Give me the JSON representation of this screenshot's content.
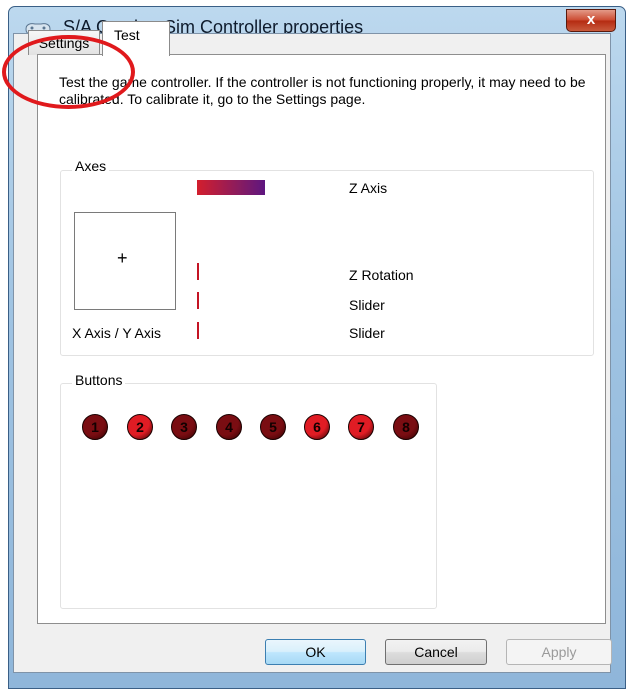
{
  "window": {
    "title": "S/A Combo. Sim Controller properties",
    "close_glyph": "x",
    "icon": "gamepad-icon"
  },
  "tabs": [
    {
      "label": "Settings"
    },
    {
      "label": "Test"
    }
  ],
  "description": "Test the game controller.  If the controller is not functioning properly, it may need to be calibrated.  To calibrate it, go to the Settings page.",
  "axes": {
    "label": "Axes",
    "xy_label": "X Axis / Y Axis",
    "z_axis": "Z Axis",
    "z_rotation": "Z Rotation",
    "slider_1": "Slider",
    "slider_2": "Slider",
    "crosshair": "+"
  },
  "buttons_group": {
    "label": "Buttons",
    "items": [
      {
        "number": "1",
        "color": "#7a0d12"
      },
      {
        "number": "2",
        "color": "#e01c24"
      },
      {
        "number": "3",
        "color": "#7a0d12"
      },
      {
        "number": "4",
        "color": "#7a0d12"
      },
      {
        "number": "5",
        "color": "#7a0d12"
      },
      {
        "number": "6",
        "color": "#e01c24"
      },
      {
        "number": "7",
        "color": "#e01c24"
      },
      {
        "number": "8",
        "color": "#7a0d12"
      }
    ]
  },
  "footer": {
    "ok": "OK",
    "cancel": "Cancel",
    "apply": "Apply"
  },
  "colors": {
    "annotation": "#e0191c",
    "indicator": "#c41424"
  }
}
